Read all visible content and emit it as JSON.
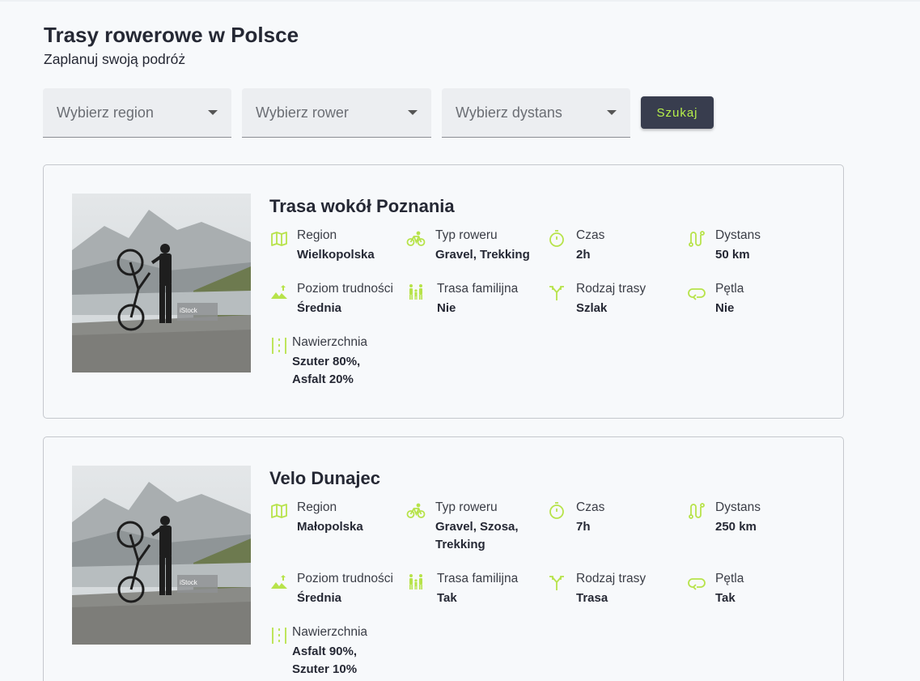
{
  "header": {
    "title": "Trasy rowerowe w Polsce",
    "subtitle": "Zaplanuj swoją podróż"
  },
  "filters": {
    "region_placeholder": "Wybierz region",
    "bike_placeholder": "Wybierz rower",
    "distance_placeholder": "Wybierz dystans",
    "search_label": "Szukaj"
  },
  "colors": {
    "accent": "#b7f04a",
    "button_bg": "#383d4e",
    "text": "#252834"
  },
  "routes": [
    {
      "name": "Trasa wokół Poznania",
      "region_label": "Region",
      "region": "Wielkopolska",
      "bike_label": "Typ roweru",
      "bike_lines": [
        "Gravel, Trekking"
      ],
      "time_label": "Czas",
      "time": "2h",
      "distance_label": "Dystans",
      "distance": "50 km",
      "difficulty_label": "Poziom trudności",
      "difficulty": "Średnia",
      "family_label": "Trasa familijna",
      "family": "Nie",
      "type_label": "Rodzaj trasy",
      "type": "Szlak",
      "loop_label": "Pętla",
      "loop": "Nie",
      "surface_label": "Nawierzchnia",
      "surface_lines": [
        "Szuter 80%,",
        "Asfalt 20%"
      ]
    },
    {
      "name": "Velo Dunajec",
      "region_label": "Region",
      "region": "Małopolska",
      "bike_label": "Typ roweru",
      "bike_lines": [
        "Gravel, Szosa,",
        "Trekking"
      ],
      "time_label": "Czas",
      "time": "7h",
      "distance_label": "Dystans",
      "distance": "250 km",
      "difficulty_label": "Poziom trudności",
      "difficulty": "Średnia",
      "family_label": "Trasa familijna",
      "family": "Tak",
      "type_label": "Rodzaj trasy",
      "type": "Trasa",
      "loop_label": "Pętla",
      "loop": "Tak",
      "surface_label": "Nawierzchnia",
      "surface_lines": [
        "Asfalt 90%,",
        "Szuter 10%"
      ]
    }
  ],
  "icons": {
    "region": "map-icon",
    "bike": "bike-icon",
    "time": "stopwatch-icon",
    "distance": "route-icon",
    "difficulty": "terrain-icon",
    "family": "family-icon",
    "type": "fork-icon",
    "loop": "loop-icon",
    "surface": "road-icon"
  },
  "photo_watermark": "iStock"
}
